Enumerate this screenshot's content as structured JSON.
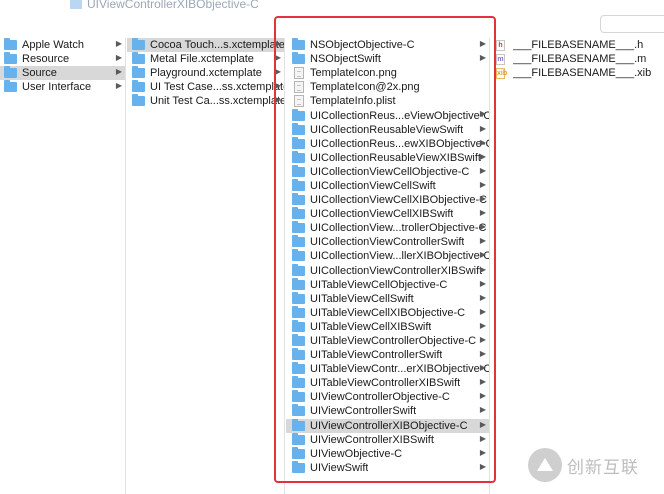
{
  "window": {
    "title": "UIViewControllerXIBObjective-C"
  },
  "column1": {
    "items": [
      {
        "label": "Apple Watch",
        "selected": false
      },
      {
        "label": "Resource",
        "selected": false
      },
      {
        "label": "Source",
        "selected": true
      },
      {
        "label": "User Interface",
        "selected": false
      }
    ]
  },
  "column2": {
    "items": [
      {
        "label": "Cocoa Touch...s.xctemplate",
        "selected": true
      },
      {
        "label": "Metal File.xctemplate",
        "selected": false
      },
      {
        "label": "Playground.xctemplate",
        "selected": false
      },
      {
        "label": "UI Test Case...ss.xctemplate",
        "selected": false
      },
      {
        "label": "Unit Test Ca...ss.xctemplate",
        "selected": false
      }
    ]
  },
  "column3": {
    "items": [
      {
        "label": "NSObjectObjective-C",
        "kind": "folder",
        "selected": false
      },
      {
        "label": "NSObjectSwift",
        "kind": "folder",
        "selected": false
      },
      {
        "label": "TemplateIcon.png",
        "kind": "file",
        "selected": false
      },
      {
        "label": "TemplateIcon@2x.png",
        "kind": "file",
        "selected": false
      },
      {
        "label": "TemplateInfo.plist",
        "kind": "file",
        "selected": false
      },
      {
        "label": "UICollectionReus...eViewObjective-C",
        "kind": "folder",
        "selected": false
      },
      {
        "label": "UICollectionReusableViewSwift",
        "kind": "folder",
        "selected": false
      },
      {
        "label": "UICollectionReus...ewXIBObjective-C",
        "kind": "folder",
        "selected": false
      },
      {
        "label": "UICollectionReusableViewXIBSwift",
        "kind": "folder",
        "selected": false
      },
      {
        "label": "UICollectionViewCellObjective-C",
        "kind": "folder",
        "selected": false
      },
      {
        "label": "UICollectionViewCellSwift",
        "kind": "folder",
        "selected": false
      },
      {
        "label": "UICollectionViewCellXIBObjective-C",
        "kind": "folder",
        "selected": false
      },
      {
        "label": "UICollectionViewCellXIBSwift",
        "kind": "folder",
        "selected": false
      },
      {
        "label": "UICollectionView...trollerObjective-C",
        "kind": "folder",
        "selected": false
      },
      {
        "label": "UICollectionViewControllerSwift",
        "kind": "folder",
        "selected": false
      },
      {
        "label": "UICollectionView...llerXIBObjective-C",
        "kind": "folder",
        "selected": false
      },
      {
        "label": "UICollectionViewControllerXIBSwift",
        "kind": "folder",
        "selected": false
      },
      {
        "label": "UITableViewCellObjective-C",
        "kind": "folder",
        "selected": false
      },
      {
        "label": "UITableViewCellSwift",
        "kind": "folder",
        "selected": false
      },
      {
        "label": "UITableViewCellXIBObjective-C",
        "kind": "folder",
        "selected": false
      },
      {
        "label": "UITableViewCellXIBSwift",
        "kind": "folder",
        "selected": false
      },
      {
        "label": "UITableViewControllerObjective-C",
        "kind": "folder",
        "selected": false
      },
      {
        "label": "UITableViewControllerSwift",
        "kind": "folder",
        "selected": false
      },
      {
        "label": "UITableViewContr...erXIBObjective-C",
        "kind": "folder",
        "selected": false
      },
      {
        "label": "UITableViewControllerXIBSwift",
        "kind": "folder",
        "selected": false
      },
      {
        "label": "UIViewControllerObjective-C",
        "kind": "folder",
        "selected": false
      },
      {
        "label": "UIViewControllerSwift",
        "kind": "folder",
        "selected": false
      },
      {
        "label": "UIViewControllerXIBObjective-C",
        "kind": "folder",
        "selected": true
      },
      {
        "label": "UIViewControllerXIBSwift",
        "kind": "folder",
        "selected": false
      },
      {
        "label": "UIViewObjective-C",
        "kind": "folder",
        "selected": false
      },
      {
        "label": "UIViewSwift",
        "kind": "folder",
        "selected": false
      }
    ]
  },
  "column4": {
    "items": [
      {
        "label": "___FILEBASENAME___.h",
        "badge": "h"
      },
      {
        "label": "___FILEBASENAME___.m",
        "badge": "m"
      },
      {
        "label": "___FILEBASENAME___.xib",
        "badge": "xib"
      }
    ]
  },
  "colors": {
    "folder": "#67b2ec",
    "selection": "#d8d8d8",
    "highlight_border": "#e2323c"
  },
  "watermark": {
    "text": "创新互联"
  }
}
